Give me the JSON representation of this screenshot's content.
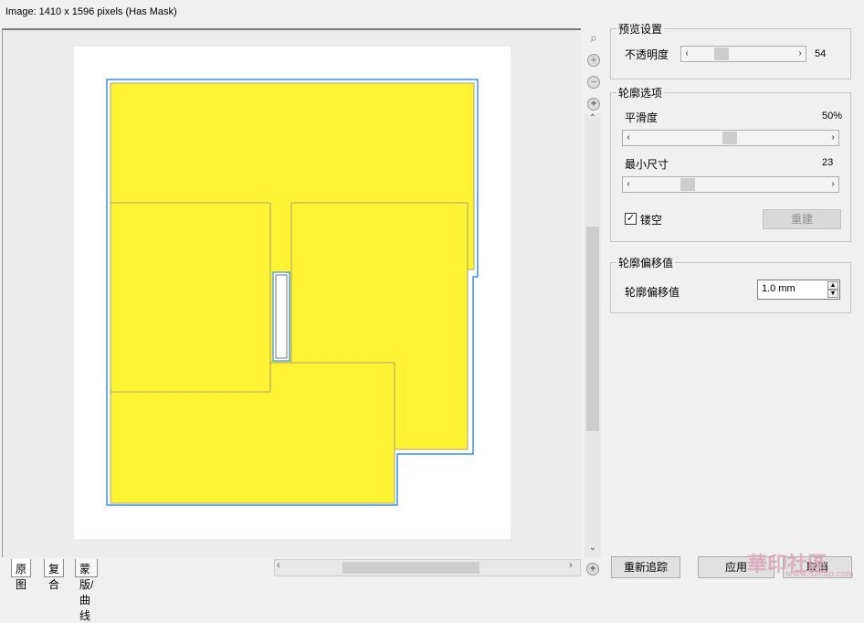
{
  "header": {
    "image_info": "Image: 1410 x 1596 pixels (Has Mask)"
  },
  "colors": {
    "shape_fill": "#fff334",
    "outline": "#3a8ee6"
  },
  "preview": {
    "tools": [
      {
        "name": "zoom-icon",
        "glyph": "⌕"
      },
      {
        "name": "zoom-in-icon",
        "glyph": "+"
      },
      {
        "name": "zoom-out-icon",
        "glyph": "−"
      },
      {
        "name": "fit-view-icon",
        "glyph": "✦"
      }
    ],
    "nav_icon": "✦"
  },
  "tabs": [
    {
      "label": "原图"
    },
    {
      "label": "复合"
    },
    {
      "label": "蒙版/曲线"
    }
  ],
  "panel": {
    "preview_settings": {
      "title": "预览设置",
      "opacity_label": "不透明度",
      "opacity_value": "54"
    },
    "contour_options": {
      "title": "轮廓选项",
      "smooth_label": "平滑度",
      "smooth_value": "50%",
      "min_size_label": "最小尺寸",
      "min_size_value": "23",
      "hollow_label": "镂空",
      "hollow_checked": "✓",
      "rebuild_label": "重建"
    },
    "offset": {
      "title": "轮廓偏移值",
      "label": "轮廓偏移值",
      "value": "1.0 mm"
    }
  },
  "footer": {
    "retrace_label": "重新追踪",
    "apply_label": "应用",
    "cancel_label": "取消"
  },
  "watermark": {
    "brand": "華印社區",
    "url": "www.52cnp.com"
  }
}
